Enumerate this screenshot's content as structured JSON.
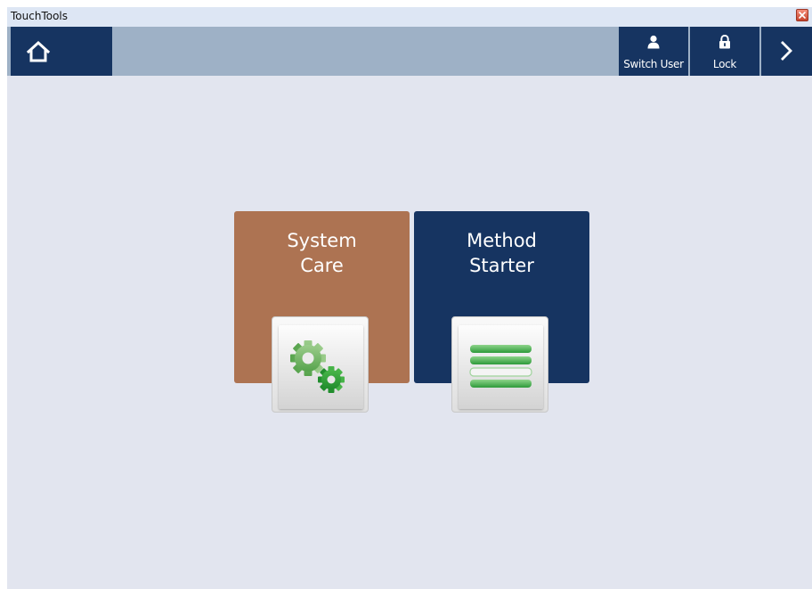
{
  "window": {
    "title": "TouchTools"
  },
  "toolbar": {
    "home_icon": "home-icon",
    "switch_user": {
      "label": "Switch User",
      "icon": "user-icon"
    },
    "lock": {
      "label": "Lock",
      "icon": "lock-icon"
    },
    "next_icon": "chevron-right-icon"
  },
  "tiles": [
    {
      "title": "System\nCare",
      "icon": "gears-icon",
      "color": "#ad7352"
    },
    {
      "title": "Method\nStarter",
      "icon": "list-icon",
      "color": "#163461"
    }
  ],
  "colors": {
    "toolbar_bg": "#9eb1c6",
    "button_bg": "#163461",
    "workspace_bg": "#e2e5ef",
    "icon_green": "#3aa845"
  }
}
